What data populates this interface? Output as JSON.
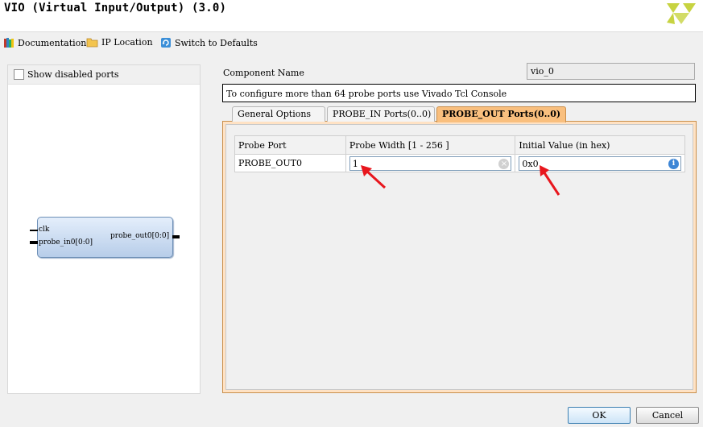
{
  "window": {
    "title": "VIO (Virtual Input/Output) (3.0)",
    "logo_icon": "xilinx-logo"
  },
  "toolbar": {
    "documentation": {
      "label": "Documentation",
      "icon": "books-icon"
    },
    "ip_location": {
      "label": "IP Location",
      "icon": "folder-icon"
    },
    "switch_defaults": {
      "label": "Switch to Defaults",
      "icon": "refresh-icon"
    }
  },
  "left_panel": {
    "show_disabled_label": "Show disabled ports",
    "block": {
      "inputs": [
        "clk",
        "probe_in0[0:0]"
      ],
      "outputs": [
        "probe_out0[0:0]"
      ]
    }
  },
  "component": {
    "name_label": "Component Name",
    "name_value": "vio_0",
    "info_text": "To configure more than 64 probe ports use Vivado Tcl Console"
  },
  "tabs": [
    {
      "label": "General Options",
      "active": false
    },
    {
      "label": "PROBE_IN Ports(0..0)",
      "active": false
    },
    {
      "label": "PROBE_OUT Ports(0..0)",
      "active": true
    }
  ],
  "probe_table": {
    "headers": [
      "Probe Port",
      "Probe Width [1 - 256 ]",
      "Initial Value (in hex)"
    ],
    "rows": [
      {
        "port": "PROBE_OUT0",
        "width": "1",
        "initial": "0x0"
      }
    ]
  },
  "buttons": {
    "ok": "OK",
    "cancel": "Cancel"
  },
  "colors": {
    "tab_active": "#f9bf7e",
    "panel_border": "#c98f4c",
    "annotation_arrow": "#e8161d",
    "block_fill": "#b7cde9"
  }
}
